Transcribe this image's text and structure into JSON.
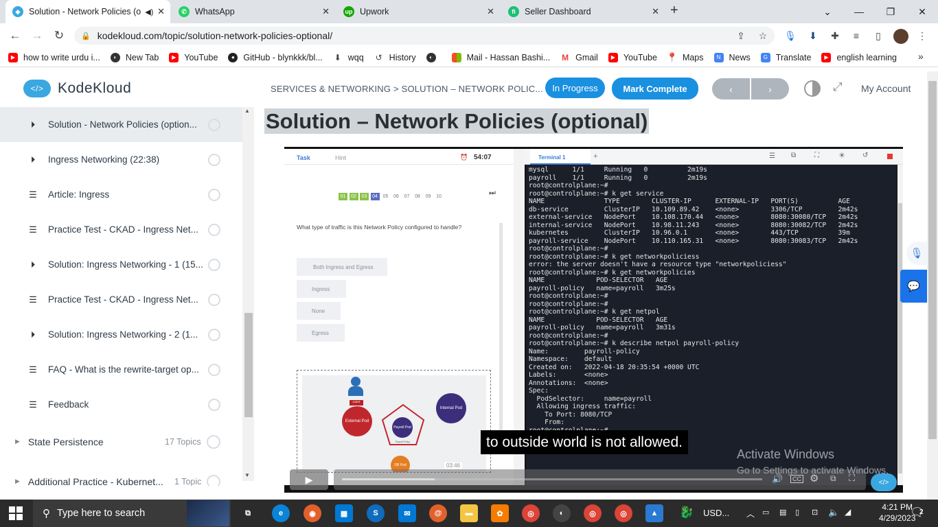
{
  "browser": {
    "tabs": [
      {
        "title": "Solution - Network Policies (o",
        "color": "#3aa7e0",
        "glyph": "◈"
      },
      {
        "title": "WhatsApp",
        "color": "#25d366",
        "glyph": "✆"
      },
      {
        "title": "Upwork",
        "color": "#14a800",
        "glyph": "up"
      },
      {
        "title": "Seller Dashboard",
        "color": "#1dbf73",
        "glyph": "fi"
      }
    ],
    "new_tab": "+",
    "url": "kodekloud.com/topic/solution-network-policies-optional/",
    "bookmarks": [
      {
        "label": "how to write urdu i...",
        "color": "#ff0000"
      },
      {
        "label": "New Tab",
        "color": "#333333"
      },
      {
        "label": "YouTube",
        "color": "#ff0000"
      },
      {
        "label": "GitHub - blynkkk/bl...",
        "color": "#222222"
      },
      {
        "label": "wqq",
        "color": "#444444"
      },
      {
        "label": "History",
        "color": "#444444"
      },
      {
        "label": "",
        "color": "#333333"
      },
      {
        "label": "Mail - Hassan Bashi...",
        "color": "#f25022"
      },
      {
        "label": "Gmail",
        "color": "#ea4335"
      },
      {
        "label": "YouTube",
        "color": "#ff0000"
      },
      {
        "label": "Maps",
        "color": "#34a853"
      },
      {
        "label": "News",
        "color": "#4285f4"
      },
      {
        "label": "Translate",
        "color": "#4285f4"
      },
      {
        "label": "english learning",
        "color": "#ff0000"
      }
    ],
    "more_bookmarks": "»"
  },
  "site": {
    "logo_text": "KodeKloud",
    "breadcrumb": "SERVICES & NETWORKING > SOLUTION – NETWORK POLIC...",
    "in_progress": "In Progress",
    "mark_complete": "Mark Complete",
    "prev": "‹",
    "next": "›",
    "my_account": "My Account"
  },
  "sidebar": {
    "lessons": [
      {
        "label": "Solution - Network Policies (option...",
        "icon": "▶",
        "active": true
      },
      {
        "label": "Ingress Networking (22:38)",
        "icon": "▶"
      },
      {
        "label": "Article: Ingress",
        "icon": "≡"
      },
      {
        "label": "Practice Test - CKAD - Ingress Net...",
        "icon": "≡"
      },
      {
        "label": "Solution: Ingress Networking - 1 (15...",
        "icon": "▶"
      },
      {
        "label": "Practice Test - CKAD - Ingress Net...",
        "icon": "≡"
      },
      {
        "label": "Solution: Ingress Networking - 2 (1...",
        "icon": "▶"
      },
      {
        "label": "FAQ - What is the rewrite-target op...",
        "icon": "≡"
      },
      {
        "label": "Feedback",
        "icon": "≡"
      }
    ],
    "sections": [
      {
        "label": "State Persistence",
        "count": "17 Topics"
      },
      {
        "label": "Additional Practice - Kubernet...",
        "count": "1 Topic"
      }
    ]
  },
  "main": {
    "title": "Solution – Network Policies (optional)"
  },
  "video": {
    "task_tab": "Task",
    "hint_tab": "Hint",
    "timer": "54:07",
    "question_numbers": [
      "01",
      "02",
      "03",
      "04",
      "05",
      "06",
      "07",
      "08",
      "09",
      "10"
    ],
    "question": "What type of traffic is this Network Policy configured to handle?",
    "options": [
      "Both Ingress and Egress",
      "Ingress",
      "None",
      "Egress"
    ],
    "diagram": {
      "external_pod": "External Pod",
      "payroll_pod": "Payroll Pod",
      "internal_pod": "Internal Pod",
      "db_pod": "DB Pod",
      "payroll_policy": "Payroll Policy",
      "user_label": "USER"
    },
    "terminal_tab": "Terminal 1",
    "terminal_lines": [
      "mysql      1/1     Running   0          2m19s",
      "payroll    1/1     Running   0          2m19s",
      "root@controlplane:~#",
      "root@controlplane:~# k get service",
      "NAME               TYPE        CLUSTER-IP      EXTERNAL-IP   PORT(S)          AGE",
      "db-service         ClusterIP   10.109.89.42    <none>        3306/TCP         2m42s",
      "external-service   NodePort    10.108.170.44   <none>        8080:30080/TCP   2m42s",
      "internal-service   NodePort    10.98.11.243    <none>        8080:30082/TCP   2m42s",
      "kubernetes         ClusterIP   10.96.0.1       <none>        443/TCP          39m",
      "payroll-service    NodePort    10.110.165.31   <none>        8080:30083/TCP   2m42s",
      "root@controlplane:~#",
      "root@controlplane:~# k get networkpoliciess",
      "error: the server doesn't have a resource type \"networkpoliciess\"",
      "root@controlplane:~# k get networkpolicies",
      "NAME             POD-SELECTOR   AGE",
      "payroll-policy   name=payroll   3m25s",
      "root@controlplane:~#",
      "root@controlplane:~#",
      "root@controlplane:~# k get netpol",
      "NAME             POD-SELECTOR   AGE",
      "payroll-policy   name=payroll   3m31s",
      "root@controlplane:~#",
      "root@controlplane:~# k describe netpol payroll-policy",
      "Name:         payroll-policy",
      "Namespace:    default",
      "Created on:   2022-04-18 20:35:54 +0000 UTC",
      "Labels:       <none>",
      "Annotations:  <none>",
      "Spec:",
      "  PodSelector:     name=payroll",
      "  Allowing ingress traffic:",
      "    To Port: 8080/TCP",
      "    From:",
      "",
      "",
      "root@controlplane:~#",
      "root@controlplane:~#"
    ],
    "caption": "to outside world is not allowed.",
    "scrub_time": "03:46",
    "progress": 0.22
  },
  "watermark": {
    "line1": "Activate Windows",
    "line2": "Go to Settings to activate Windows."
  },
  "taskbar": {
    "search_placeholder": "Type here to search",
    "weather": "USD...",
    "time": "4:21 PM",
    "date": "4/29/2023",
    "notification_count": "2"
  }
}
